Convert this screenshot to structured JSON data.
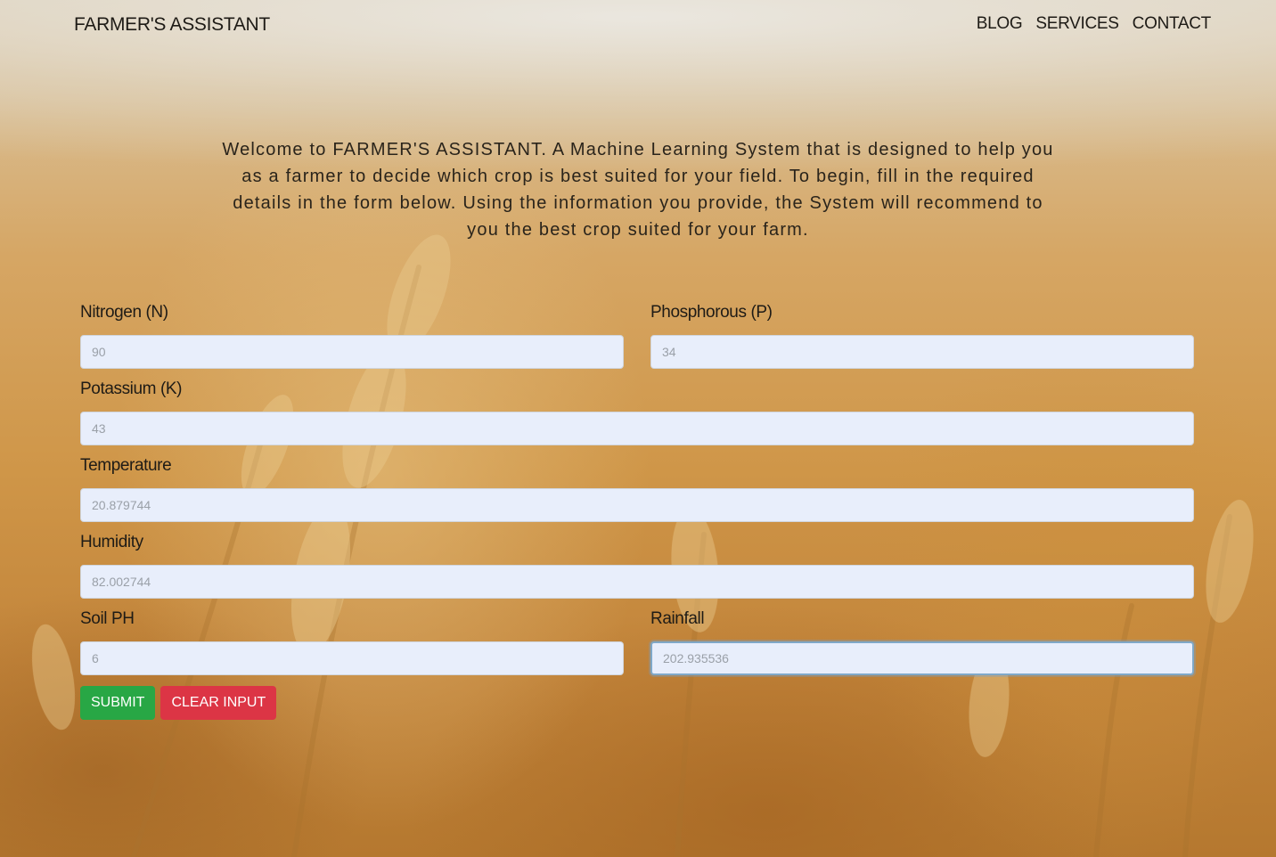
{
  "header": {
    "brand": "FARMER'S ASSISTANT",
    "nav": [
      "BLOG",
      "SERVICES",
      "CONTACT"
    ]
  },
  "intro": "Welcome to FARMER'S ASSISTANT. A Machine Learning System that is designed to help you as a farmer to decide which crop is best suited for your field. To begin, fill in the required details in the form below. Using the information you provide, the System will recommend to you the best crop suited for your farm.",
  "form": {
    "nitrogen": {
      "label": "Nitrogen (N)",
      "value": "90"
    },
    "phosphorous": {
      "label": "Phosphorous (P)",
      "value": "34"
    },
    "potassium": {
      "label": "Potassium (K)",
      "value": "43"
    },
    "temperature": {
      "label": "Temperature",
      "value": "20.879744"
    },
    "humidity": {
      "label": "Humidity",
      "value": "82.002744"
    },
    "soil_ph": {
      "label": "Soil PH",
      "value": "6"
    },
    "rainfall": {
      "label": "Rainfall",
      "value": "202.935536"
    },
    "submit_label": "SUBMIT",
    "clear_label": "CLEAR INPUT"
  },
  "colors": {
    "submit": "#28a745",
    "clear": "#dc3545",
    "input_bg": "#e8eefb"
  }
}
